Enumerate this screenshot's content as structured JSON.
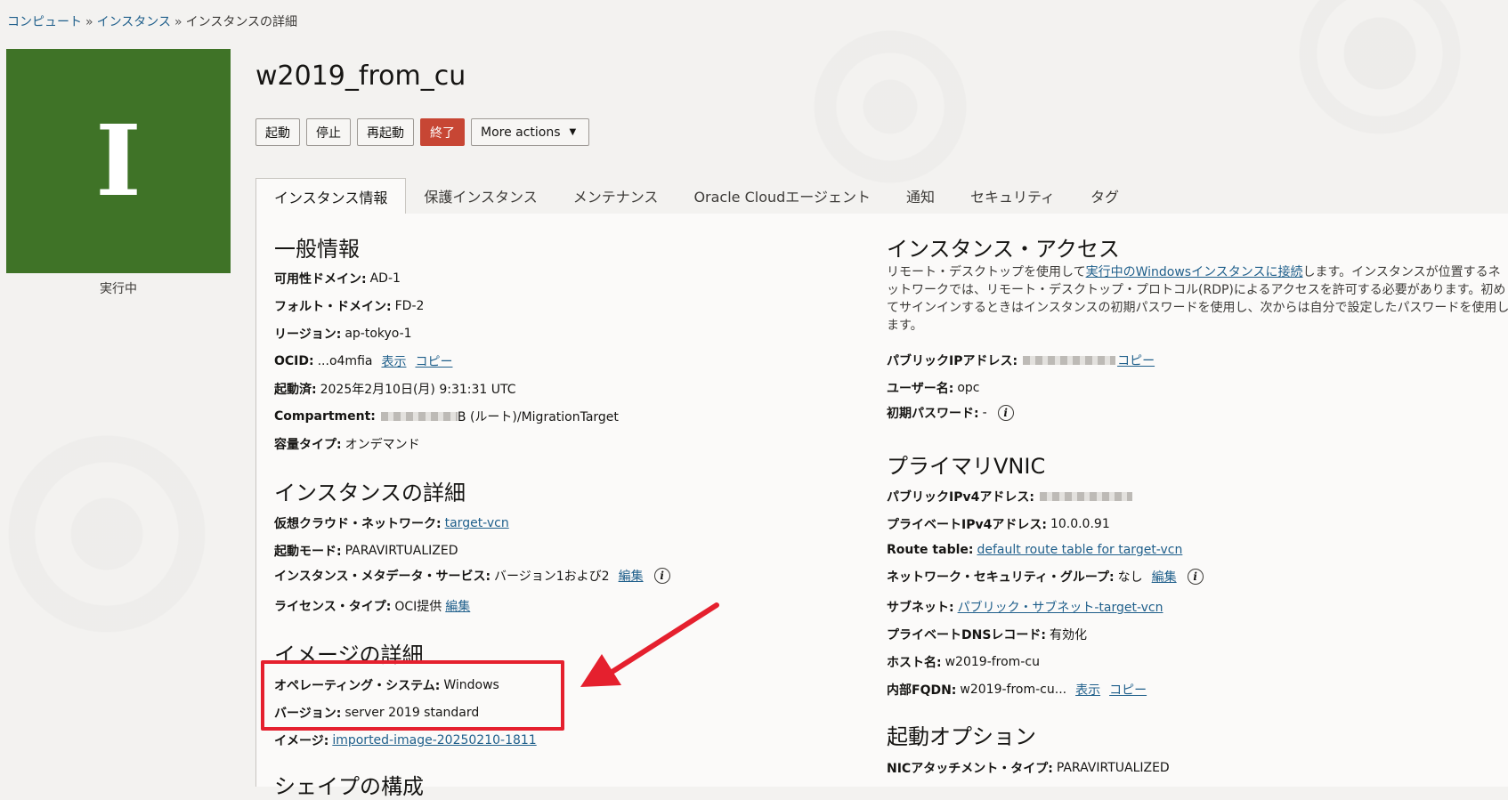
{
  "breadcrumb": {
    "compute": "コンピュート",
    "instances": "インスタンス",
    "current": "インスタンスの詳細",
    "sep": "»"
  },
  "avatar": {
    "letter": "I",
    "status": "実行中",
    "color": "#3f7327"
  },
  "title": "w2019_from_cu",
  "toolbar": {
    "start": "起動",
    "stop": "停止",
    "reboot": "再起動",
    "terminate": "終了",
    "more": "More actions"
  },
  "tabs": [
    "インスタンス情報",
    "保護インスタンス",
    "メンテナンス",
    "Oracle Cloudエージェント",
    "通知",
    "セキュリティ",
    "タグ"
  ],
  "general": {
    "title": "一般情報",
    "ad_k": "可用性ドメイン:",
    "ad_v": "AD-1",
    "fd_k": "フォルト・ドメイン:",
    "fd_v": "FD-2",
    "region_k": "リージョン:",
    "region_v": "ap-tokyo-1",
    "ocid_k": "OCID:",
    "ocid_v": "...o4mfia",
    "show": "表示",
    "copy": "コピー",
    "launched_k": "起動済:",
    "launched_v": "2025年2月10日(月) 9:31:31 UTC",
    "compartment_k": "Compartment:",
    "compartment_v": "B (ルート)/MigrationTarget",
    "capacity_k": "容量タイプ:",
    "capacity_v": "オンデマンド"
  },
  "instance_details": {
    "title": "インスタンスの詳細",
    "vcn_k": "仮想クラウド・ネットワーク:",
    "vcn_v": "target-vcn",
    "launch_mode_k": "起動モード:",
    "launch_mode_v": "PARAVIRTUALIZED",
    "metadata_k": "インスタンス・メタデータ・サービス:",
    "metadata_v": "バージョン1および2",
    "edit": "編集",
    "license_k": "ライセンス・タイプ:",
    "license_v": "OCI提供"
  },
  "image_details": {
    "title": "イメージの詳細",
    "os_k": "オペレーティング・システム:",
    "os_v": "Windows",
    "version_k": "バージョン:",
    "version_v": "server 2019 standard",
    "image_k": "イメージ:",
    "image_v": "imported-image-20250210-1811"
  },
  "shape": {
    "title": "シェイプの構成"
  },
  "access": {
    "title": "インスタンス・アクセス",
    "para_pre": "リモート・デスクトップを使用して",
    "para_link": "実行中のWindowsインスタンスに接続",
    "para_post": "します。インスタンスが位置するネットワークでは、リモート・デスクトップ・プロトコル(RDP)によるアクセスを許可する必要があります。初めてサインインするときはインスタンスの初期パスワードを使用し、次からは自分で設定したパスワードを使用します。",
    "public_ip_k": "パブリックIPアドレス:",
    "copy": "コピー",
    "user_k": "ユーザー名:",
    "user_v": "opc",
    "pw_k": "初期パスワード:",
    "pw_v": "-"
  },
  "vnic": {
    "title": "プライマリVNIC",
    "pub_ipv4_k": "パブリックIPv4アドレス:",
    "priv_ipv4_k": "プライベートIPv4アドレス:",
    "priv_ipv4_v": "10.0.0.91",
    "route_k": "Route table:",
    "route_v": "default route table for target-vcn",
    "nsg_k": "ネットワーク・セキュリティ・グループ:",
    "nsg_v": "なし",
    "edit": "編集",
    "subnet_k": "サブネット:",
    "subnet_v": "パブリック・サブネット-target-vcn",
    "dns_k": "プライベートDNSレコード:",
    "dns_v": "有効化",
    "host_k": "ホスト名:",
    "host_v": "w2019-from-cu",
    "fqdn_k": "内部FQDN:",
    "fqdn_v": "w2019-from-cu...",
    "show": "表示",
    "copy": "コピー"
  },
  "launch_options": {
    "title": "起動オプション",
    "nic_k": "NICアタッチメント・タイプ:",
    "nic_v": "PARAVIRTUALIZED"
  },
  "annotation_color": "#e5202e"
}
